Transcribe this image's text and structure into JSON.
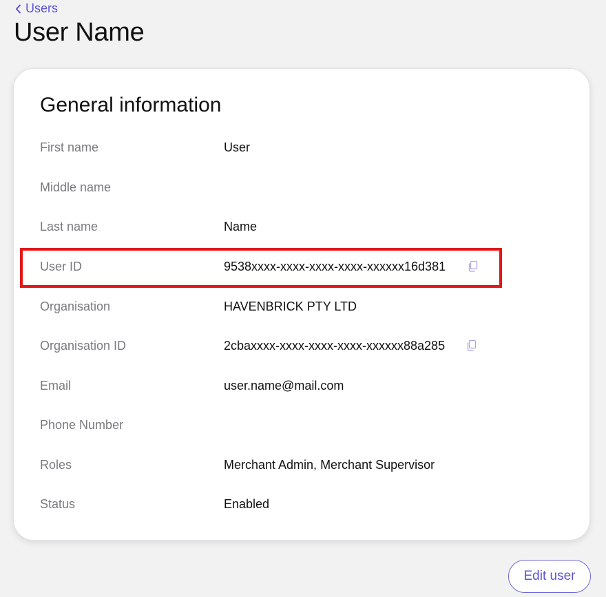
{
  "breadcrumb": {
    "back_label": "Users"
  },
  "page": {
    "title": "User Name"
  },
  "general_info": {
    "title": "General information",
    "fields": [
      {
        "label": "First name",
        "value": "User"
      },
      {
        "label": "Middle name",
        "value": ""
      },
      {
        "label": "Last name",
        "value": "Name"
      },
      {
        "label": "User ID",
        "value": "9538xxxx-xxxx-xxxx-xxxx-xxxxxx16d381"
      },
      {
        "label": "Organisation",
        "value": "HAVENBRICK PTY LTD"
      },
      {
        "label": "Organisation ID",
        "value": "2cbaxxxx-xxxx-xxxx-xxxx-xxxxxx88a285"
      },
      {
        "label": "Email",
        "value": "user.name@mail.com"
      },
      {
        "label": "Phone Number",
        "value": ""
      },
      {
        "label": "Roles",
        "value": "Merchant Admin, Merchant Supervisor"
      },
      {
        "label": "Status",
        "value": "Enabled"
      }
    ]
  },
  "actions": {
    "edit_label": "Edit user"
  },
  "icons": {
    "back": "chevron-left-icon",
    "copy": "copy-icon"
  },
  "colors": {
    "accent": "#5b54d6",
    "highlight": "#e01818",
    "background": "#f2f2f3",
    "label": "#7a7a7f"
  }
}
